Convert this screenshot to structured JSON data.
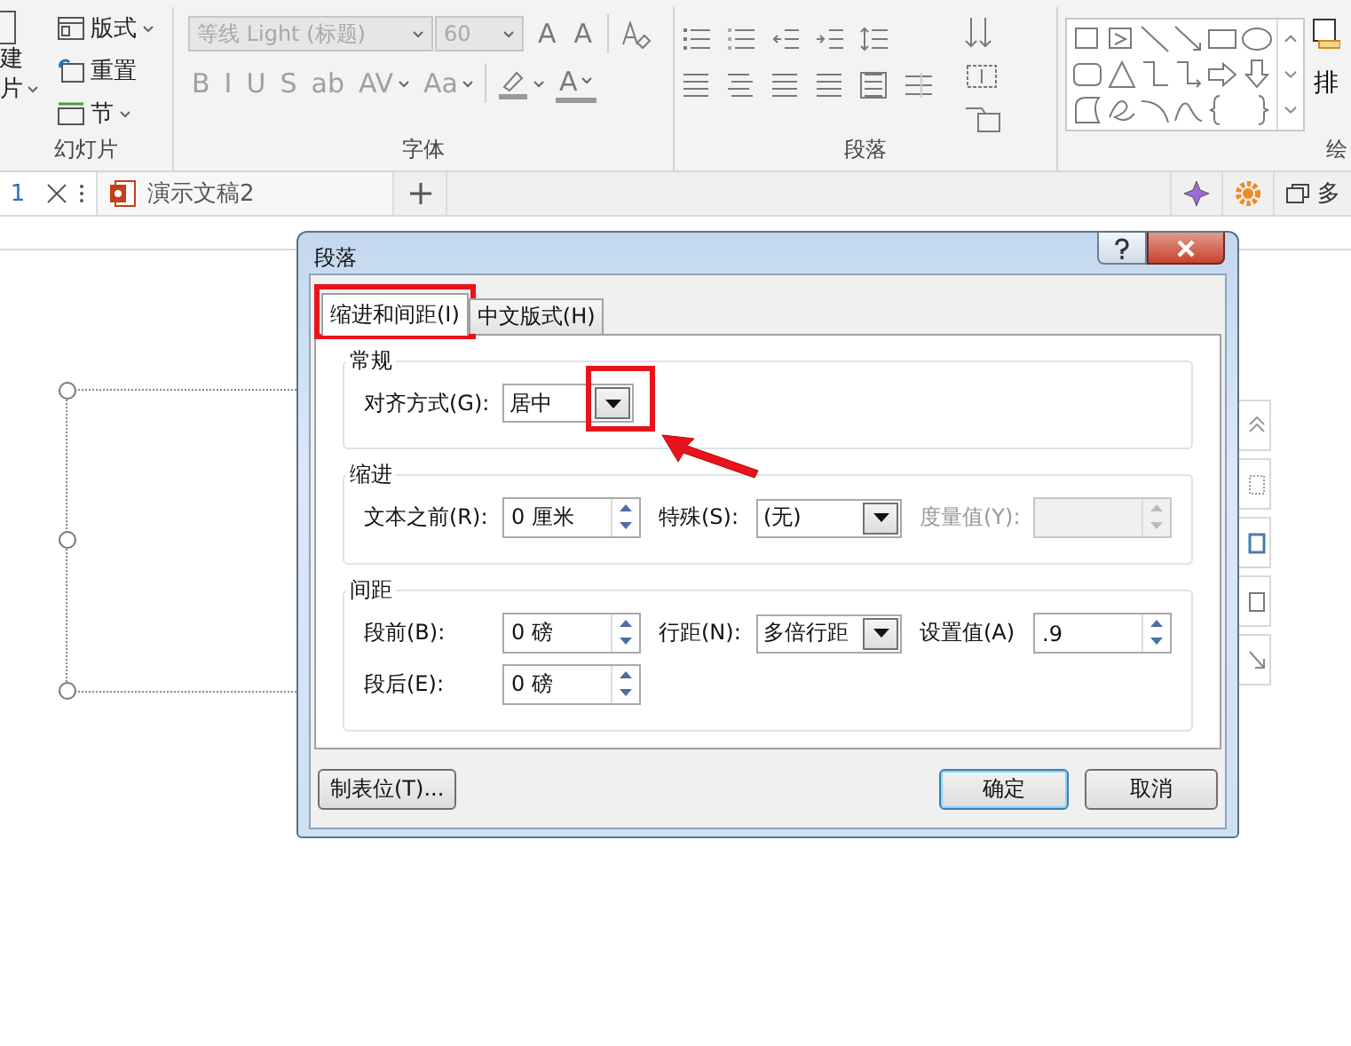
{
  "ribbon": {
    "slides_group": {
      "label": "幻灯片",
      "new_slide": {
        "lines": [
          "建",
          "片"
        ]
      },
      "commands": [
        {
          "label": "版式",
          "dropdown": true
        },
        {
          "label": "重置",
          "dropdown": false
        },
        {
          "label": "节",
          "dropdown": true
        }
      ]
    },
    "font_group": {
      "label": "字体",
      "font_name": "等线 Light (标题)",
      "font_size": "60",
      "disabled": true,
      "size_buttons": [
        {
          "text": "A"
        },
        {
          "text": "A"
        }
      ],
      "format_buttons": [
        {
          "text": "B",
          "dropdown": false
        },
        {
          "text": "I",
          "dropdown": false
        },
        {
          "text": "U",
          "dropdown": false
        },
        {
          "text": "S",
          "dropdown": false
        },
        {
          "text": "ab",
          "dropdown": false
        },
        {
          "text": "AV",
          "dropdown": true
        },
        {
          "text": "Aa",
          "dropdown": true
        }
      ],
      "color_buttons": [
        {
          "kind": "highlight"
        },
        {
          "kind": "font_color",
          "text": "A"
        }
      ]
    },
    "paragraph_group": {
      "label": "段落"
    },
    "drawing_group": {
      "label": "绘",
      "arrange": "排"
    }
  },
  "tabs": [
    {
      "label": "1",
      "selected": true,
      "kind": "plain"
    },
    {
      "label": "演示文稿2",
      "selected": false,
      "kind": "presentation"
    }
  ],
  "tabbar_right": {
    "window_label": "多"
  },
  "dialog": {
    "title": "段落",
    "tabs": [
      {
        "label": "缩进和间距(I)",
        "selected": true,
        "highlighted": true
      },
      {
        "label": "中文版式(H)",
        "selected": false
      }
    ],
    "sections": [
      {
        "title": "常规",
        "rows": [
          [
            {
              "label": "对齐方式(G):",
              "kind": "select",
              "value": "居中",
              "highlighted": true,
              "arrow": true
            }
          ]
        ]
      },
      {
        "title": "缩进",
        "rows": [
          [
            {
              "label": "文本之前(R):",
              "kind": "spin",
              "value": "0 厘米",
              "disabled": false
            },
            {
              "label": "特殊(S):",
              "kind": "select",
              "value": "(无)"
            },
            {
              "label": "度量值(Y):",
              "kind": "spin",
              "disabled": true
            }
          ]
        ]
      },
      {
        "title": "间距",
        "rows": [
          [
            {
              "label": "段前(B):",
              "kind": "spin",
              "value": "0 磅",
              "disabled": false
            },
            {
              "label": "行距(N):",
              "kind": "select",
              "value": "多倍行距"
            },
            {
              "label": "设置值(A)",
              "kind": "spin",
              "value": ".9",
              "disabled": false
            }
          ],
          [
            {
              "label": "段后(E):",
              "kind": "spin",
              "value": "0 磅",
              "disabled": false
            }
          ]
        ]
      }
    ],
    "buttons": [
      {
        "label": "制表位(T)...",
        "default": false,
        "kind": "left"
      },
      {
        "label": "确定",
        "default": true,
        "kind": "right"
      },
      {
        "label": "取消",
        "default": false,
        "kind": "right"
      }
    ]
  }
}
